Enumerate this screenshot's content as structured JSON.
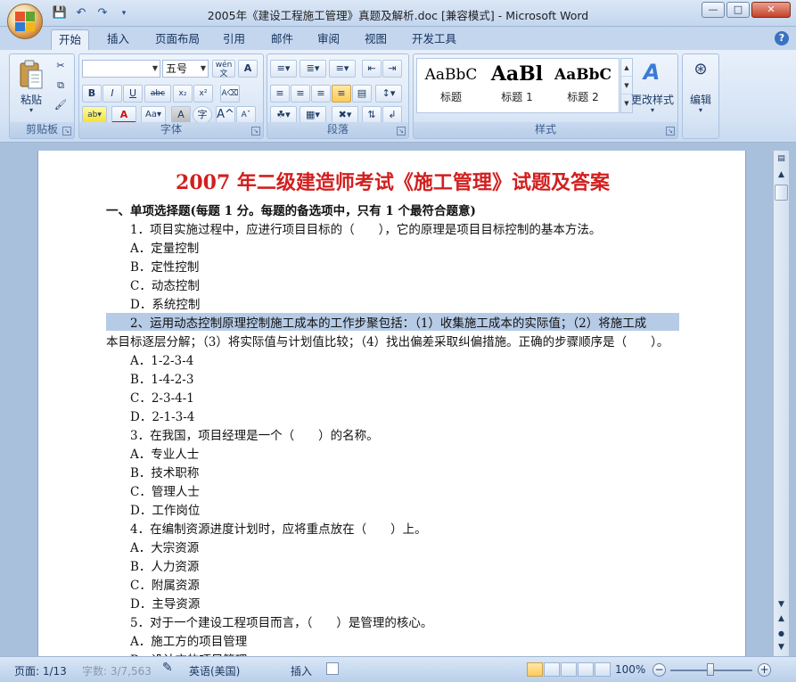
{
  "window": {
    "title": "2005年《建设工程施工管理》真题及解析.doc [兼容模式] - Microsoft Word"
  },
  "qat": {
    "save_icon": "save-icon",
    "undo_icon": "undo-icon",
    "redo_icon": "redo-icon"
  },
  "tabs": [
    {
      "label": "开始"
    },
    {
      "label": "插入"
    },
    {
      "label": "页面布局"
    },
    {
      "label": "引用"
    },
    {
      "label": "邮件"
    },
    {
      "label": "审阅"
    },
    {
      "label": "视图"
    },
    {
      "label": "开发工具"
    }
  ],
  "ribbon": {
    "clipboard": {
      "label": "剪贴板",
      "paste_label": "粘贴"
    },
    "font": {
      "label": "字体",
      "font_name": "",
      "font_size": "五号",
      "wen_label": "wén"
    },
    "paragraph": {
      "label": "段落"
    },
    "styles": {
      "label": "样式",
      "items": [
        {
          "sample": "AaBbC",
          "name": "标题"
        },
        {
          "sample": "AaBl",
          "name": "标题 1"
        },
        {
          "sample": "AaBbC",
          "name": "标题 2"
        }
      ],
      "change_label": "更改样式"
    },
    "editing": {
      "label": "编辑"
    }
  },
  "document": {
    "title": "2007 年二级建造师考试《施工管理》试题及答案",
    "lines": [
      {
        "text": "一、单项选择题(每题 1 分。每题的备选项中，只有 1 个最符合题意)",
        "style": "section",
        "indent": 0
      },
      {
        "text": "1．项目实施过程中，应进行项目目标的（　　），它的原理是项目目标控制的基本方法。",
        "style": "",
        "indent": 1
      },
      {
        "text": "A．定量控制",
        "style": "",
        "indent": 1
      },
      {
        "text": "B．定性控制",
        "style": "",
        "indent": 1
      },
      {
        "text": "C．动态控制",
        "style": "",
        "indent": 1
      },
      {
        "text": "D．系统控制",
        "style": "",
        "indent": 1
      },
      {
        "text": "　　2、运用动态控制原理控制施工成本的工作步聚包括：（1）收集施工成本的实际值；（2）将施工成",
        "style": "hl",
        "indent": 0
      },
      {
        "text": "本目标逐层分解；（3）将实际值与计划值比较；（4）找出偏差采取纠偏措施。正确的步骤顺序是（　　）。",
        "style": "",
        "indent": 0
      },
      {
        "text": "A．1-2-3-4",
        "style": "",
        "indent": 1
      },
      {
        "text": "B．1-4-2-3",
        "style": "",
        "indent": 1
      },
      {
        "text": "C．2-3-4-1",
        "style": "",
        "indent": 1
      },
      {
        "text": "D．2-1-3-4",
        "style": "",
        "indent": 1
      },
      {
        "text": "3．在我国，项目经理是一个（　　）的名称。",
        "style": "",
        "indent": 1
      },
      {
        "text": "A．专业人士",
        "style": "",
        "indent": 1
      },
      {
        "text": "B．技术职称",
        "style": "",
        "indent": 1
      },
      {
        "text": "C．管理人士",
        "style": "",
        "indent": 1
      },
      {
        "text": "D．工作岗位",
        "style": "",
        "indent": 1
      },
      {
        "text": "4．在编制资源进度计划时，应将重点放在（　　）上。",
        "style": "",
        "indent": 1
      },
      {
        "text": "A．大宗资源",
        "style": "",
        "indent": 1
      },
      {
        "text": "B．人力资源",
        "style": "",
        "indent": 1
      },
      {
        "text": "C．附属资源",
        "style": "",
        "indent": 1
      },
      {
        "text": "D．主导资源",
        "style": "",
        "indent": 1
      },
      {
        "text": "5．对于一个建设工程项目而言，（　　）是管理的核心。",
        "style": "",
        "indent": 1
      },
      {
        "text": "A．施工方的项目管理",
        "style": "",
        "indent": 1
      },
      {
        "text": "B．设计方的项目管理",
        "style": "",
        "indent": 1
      }
    ]
  },
  "status": {
    "page": "页面: 1/13",
    "words": "字数: 3/7,563",
    "language": "英语(美国)",
    "insert": "插入",
    "zoom": "100%"
  }
}
